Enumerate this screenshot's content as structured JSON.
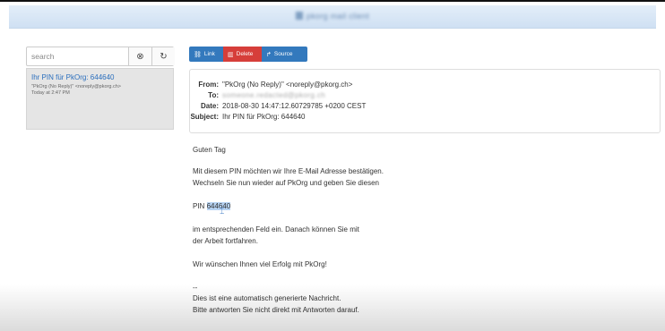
{
  "header": {
    "title": "pkorg mail client"
  },
  "sidebar": {
    "search": {
      "placeholder": "search",
      "value": ""
    },
    "clear_icon": "⊗",
    "refresh_icon": "↻",
    "mail_item": {
      "subject": "Ihr PIN für PkOrg: 644640",
      "sender": "\"PkOrg (No Reply)\" <noreply@pkorg.ch>",
      "time": "Today at 2:47 PM"
    }
  },
  "toolbar": {
    "link_label": "Link",
    "delete_label": "Delete",
    "source_label": "Source",
    "link_icon": "🔗",
    "delete_icon": "🗑",
    "source_icon": "↱"
  },
  "message": {
    "from_label": "From:",
    "from_value": "\"PkOrg (No Reply)\" <noreply@pkorg.ch>",
    "to_label": "To:",
    "to_value": "someone.redacted@pkorg.ch",
    "date_label": "Date:",
    "date_value": "2018-08-30 14:47:12.60729785 +0200 CEST",
    "subject_label": "Subject:",
    "subject_value": "Ihr PIN für PkOrg: 644640",
    "body": {
      "greeting": "Guten Tag",
      "line1": "Mit diesem PIN möchten wir Ihre E-Mail Adresse bestätigen.",
      "line2": "Wechseln Sie nun wieder auf PkOrg und geben Sie diesen",
      "pin_prefix": "PIN ",
      "pin_value": "644640",
      "line3": "im entsprechenden Feld ein. Danach können Sie mit",
      "line4": "der Arbeit fortfahren.",
      "line5": "Wir wünschen Ihnen viel Erfolg mit PkOrg!",
      "sig_sep": "--",
      "sig1": "Dies ist eine automatisch generierte Nachricht.",
      "sig2": "Bitte antworten Sie nicht direkt mit Antworten darauf."
    }
  },
  "colors": {
    "accent_blue": "#3379bd",
    "danger_red": "#d63e3a",
    "link_blue": "#2a6ebd",
    "selection": "#b7d3f3"
  }
}
